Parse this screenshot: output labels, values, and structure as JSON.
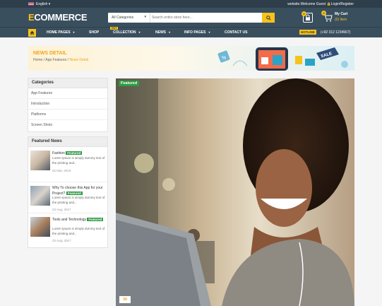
{
  "topbar": {
    "language": "English",
    "welcome": "website.Welcome Guest",
    "login": "Login/Register"
  },
  "header": {
    "logo_e": "E",
    "logo_rest": "COMMERCE",
    "category": "All Categories",
    "search_placeholder": "Search entire store here...",
    "cart_badge": "0",
    "lock_badge": "0",
    "my_cart": "My Cart",
    "items": "(0) Item"
  },
  "nav": {
    "items": [
      {
        "label": "HOME PAGES"
      },
      {
        "label": "SHOP"
      },
      {
        "label": "COLLECTION"
      },
      {
        "label": "NEWS"
      },
      {
        "label": "INFO PAGES"
      },
      {
        "label": "CONTACT US"
      }
    ],
    "hot": "HOT",
    "hotline": "HOTLINE",
    "phone": "(+92 312 1234567)"
  },
  "banner": {
    "title": "NEWS DETAIL",
    "crumb_home": "Home",
    "crumb_sep": "/",
    "crumb_mid": "App Features",
    "crumb_cur": "News Detail",
    "sale": "SALE"
  },
  "categories": {
    "title": "Categories",
    "items": [
      "App Features",
      "Introduction",
      "Platforms",
      "Screen Shots"
    ]
  },
  "featured": {
    "title": "Featured News",
    "badge": "Featured",
    "posts": [
      {
        "title": "Fashion",
        "desc": "Lorem Ipsum is simply dummy text of the printing and...",
        "date": "02 Mar, 2018"
      },
      {
        "title": "Why To choose this App for your Project?",
        "desc": "Lorem Ipsum is simply dummy text of the printing and...",
        "date": "23 Aug, 2017"
      },
      {
        "title": "Tools and Technology",
        "desc": "Lorem Ipsum is simply dummy text of the printing and...",
        "date": "23 Aug, 2017"
      }
    ]
  },
  "main": {
    "featured": "Featured",
    "number": "30"
  },
  "colors": {
    "accent": "#f6c31c",
    "header": "#3a4f5e",
    "topbar": "#2e3e4b",
    "green": "#2f9a45"
  }
}
